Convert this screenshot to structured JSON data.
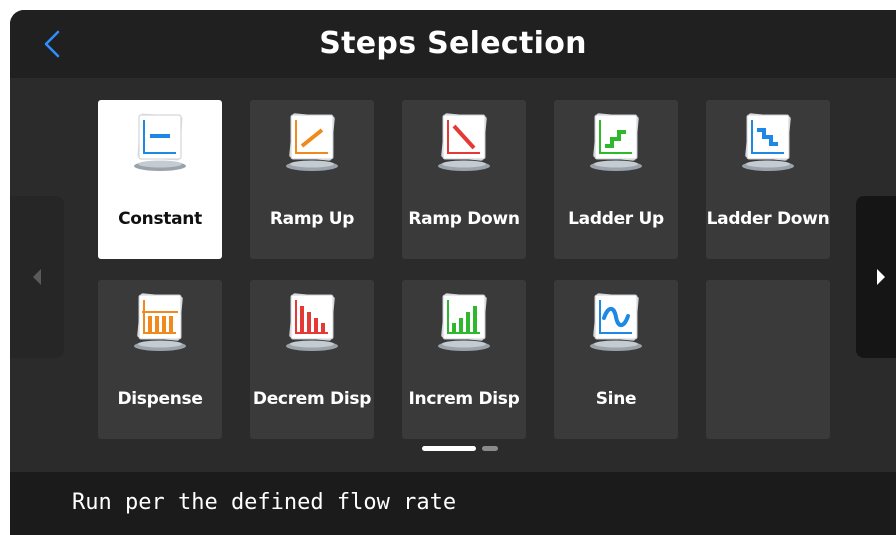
{
  "header": {
    "title": "Steps Selection",
    "back_icon": "chevron-left-icon"
  },
  "colors": {
    "accent": "#2f8fff",
    "tile_bg": "#3a3a3a",
    "tile_selected_bg": "#ffffff",
    "screen_bg": "#2b2b2b",
    "header_bg": "#202020"
  },
  "steps": [
    {
      "id": "constant",
      "label": "Constant",
      "icon": "constant-icon",
      "color": "#1e88e5",
      "selected": true
    },
    {
      "id": "ramp-up",
      "label": "Ramp Up",
      "icon": "ramp-up-icon",
      "color": "#ef8a1c",
      "selected": false
    },
    {
      "id": "ramp-down",
      "label": "Ramp Down",
      "icon": "ramp-down-icon",
      "color": "#e53935",
      "selected": false
    },
    {
      "id": "ladder-up",
      "label": "Ladder Up",
      "icon": "ladder-up-icon",
      "color": "#2eb82e",
      "selected": false
    },
    {
      "id": "ladder-down",
      "label": "Ladder Down",
      "icon": "ladder-down-icon",
      "color": "#1e88e5",
      "selected": false
    },
    {
      "id": "dispense",
      "label": "Dispense",
      "icon": "dispense-icon",
      "color": "#ef8a1c",
      "selected": false
    },
    {
      "id": "decrem-disp",
      "label": "Decrem Disp",
      "icon": "decrem-disp-icon",
      "color": "#e53935",
      "selected": false
    },
    {
      "id": "increm-disp",
      "label": "Increm Disp",
      "icon": "increm-disp-icon",
      "color": "#2eb82e",
      "selected": false
    },
    {
      "id": "sine",
      "label": "Sine",
      "icon": "sine-icon",
      "color": "#1e88e5",
      "selected": false
    }
  ],
  "pagination": {
    "current_page": 1,
    "total_pages": 2
  },
  "nav": {
    "prev_icon": "arrow-left-icon",
    "next_icon": "arrow-right-icon"
  },
  "footer": {
    "description": "Run per the defined flow rate"
  }
}
